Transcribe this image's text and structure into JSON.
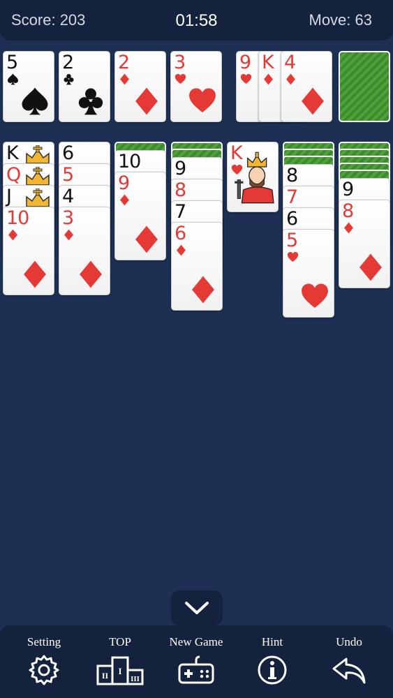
{
  "header": {
    "score_text": "Score: 203",
    "timer": "01:58",
    "moves_text": "Move: 63"
  },
  "foundations": [
    {
      "rank": "5",
      "suit": "spade"
    },
    {
      "rank": "2",
      "suit": "club"
    },
    {
      "rank": "2",
      "suit": "diamond"
    },
    {
      "rank": "3",
      "suit": "heart"
    }
  ],
  "waste": [
    {
      "rank": "9",
      "suit": "heart"
    },
    {
      "rank": "K",
      "suit": "diamond"
    },
    {
      "rank": "4",
      "suit": "diamond"
    }
  ],
  "stock": {
    "face_down": true
  },
  "tableau": [
    {
      "face_down": 0,
      "cards": [
        {
          "rank": "K",
          "suit": "club",
          "face": true
        },
        {
          "rank": "Q",
          "suit": "heart",
          "face": true
        },
        {
          "rank": "J",
          "suit": "spade",
          "face": true
        },
        {
          "rank": "10",
          "suit": "diamond"
        }
      ]
    },
    {
      "face_down": 0,
      "cards": [
        {
          "rank": "6",
          "suit": "spade"
        },
        {
          "rank": "5",
          "suit": "diamond"
        },
        {
          "rank": "4",
          "suit": "spade"
        },
        {
          "rank": "3",
          "suit": "diamond"
        }
      ]
    },
    {
      "face_down": 1,
      "cards": [
        {
          "rank": "10",
          "suit": "spade"
        },
        {
          "rank": "9",
          "suit": "diamond"
        }
      ]
    },
    {
      "face_down": 2,
      "cards": [
        {
          "rank": "9",
          "suit": "spade"
        },
        {
          "rank": "8",
          "suit": "diamond"
        },
        {
          "rank": "7",
          "suit": "spade"
        },
        {
          "rank": "6",
          "suit": "diamond"
        }
      ]
    },
    {
      "face_down": 0,
      "cards": [
        {
          "rank": "K",
          "suit": "heart",
          "face": true
        }
      ]
    },
    {
      "face_down": 3,
      "cards": [
        {
          "rank": "8",
          "suit": "spade"
        },
        {
          "rank": "7",
          "suit": "diamond"
        },
        {
          "rank": "6",
          "suit": "spade"
        },
        {
          "rank": "5",
          "suit": "heart"
        }
      ]
    },
    {
      "face_down": 5,
      "cards": [
        {
          "rank": "9",
          "suit": "spade"
        },
        {
          "rank": "8",
          "suit": "diamond"
        }
      ]
    }
  ],
  "nav": [
    {
      "label": "Setting",
      "icon": "gear-icon"
    },
    {
      "label": "TOP",
      "icon": "podium-icon"
    },
    {
      "label": "New Game",
      "icon": "gamepad-icon"
    },
    {
      "label": "Hint",
      "icon": "info-icon"
    },
    {
      "label": "Undo",
      "icon": "undo-icon"
    }
  ],
  "colors": {
    "background": "#1d2f52",
    "bar": "#14223d",
    "red_suit": "#e53935",
    "card_back": "#4ea23a"
  }
}
